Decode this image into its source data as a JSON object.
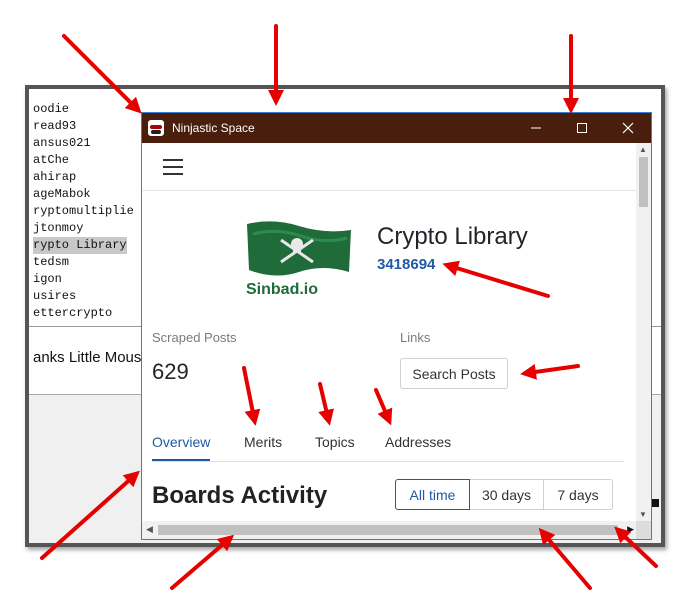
{
  "background_app": {
    "list_items": [
      "oodie",
      "read93",
      "ansus021",
      "atChe",
      "ahirap",
      "ageMabok",
      "ryptomultiplie",
      "jtonmoy",
      "rypto Library",
      "tedsm",
      "igon",
      "usires",
      "ettercrypto"
    ],
    "selected_index": 8,
    "message": "anks Little Mous"
  },
  "window": {
    "title": "Ninjastic Space",
    "minimize_icon": "minimize-icon",
    "maximize_icon": "maximize-icon",
    "close_icon": "close-icon"
  },
  "navbar": {
    "menu_icon": "hamburger-menu-icon"
  },
  "profile": {
    "logo_text": "Sinbad.io",
    "name": "Crypto Library",
    "id": "3418694"
  },
  "stats": {
    "scraped_label": "Scraped Posts",
    "scraped_value": "629",
    "links_label": "Links",
    "search_button": "Search Posts"
  },
  "tabs": [
    {
      "label": "Overview",
      "active": true
    },
    {
      "label": "Merits",
      "active": false
    },
    {
      "label": "Topics",
      "active": false
    },
    {
      "label": "Addresses",
      "active": false
    }
  ],
  "boards": {
    "title": "Boards Activity",
    "ranges": [
      {
        "label": "All time",
        "active": true
      },
      {
        "label": "30 days",
        "active": false
      },
      {
        "label": "7 days",
        "active": false
      }
    ]
  },
  "colors": {
    "titlebar": "#4a1e0c",
    "accent": "#1f5aa6",
    "arrow": "#e60000",
    "flag": "#1f6b3a"
  }
}
